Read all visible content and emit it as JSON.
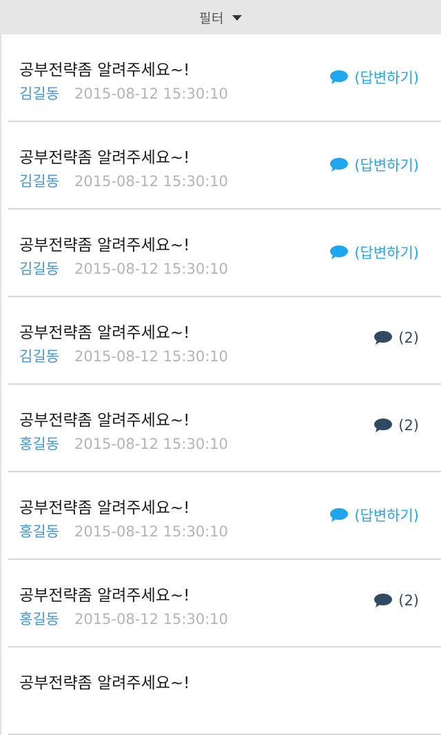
{
  "filter": {
    "label": "필터",
    "caret_icon": "caret-down-icon"
  },
  "colors": {
    "header_bg": "#e6e6e6",
    "author": "#3b96d8",
    "date": "#b4b4b4",
    "answer_accent": "#1ea7ee",
    "count_accent": "#2f4a62"
  },
  "questions": [
    {
      "title": "공부전략좀 알려주세요~!",
      "author": "김길동",
      "datetime": "2015-08-12 15:30:10",
      "action_type": "answer",
      "action_label": "(답변하기)",
      "icon": "speech-bubble-icon"
    },
    {
      "title": "공부전략좀 알려주세요~!",
      "author": "김길동",
      "datetime": "2015-08-12 15:30:10",
      "action_type": "answer",
      "action_label": "(답변하기)",
      "icon": "speech-bubble-icon"
    },
    {
      "title": "공부전략좀 알려주세요~!",
      "author": "김길동",
      "datetime": "2015-08-12 15:30:10",
      "action_type": "answer",
      "action_label": "(답변하기)",
      "icon": "speech-bubble-icon"
    },
    {
      "title": "공부전략좀 알려주세요~!",
      "author": "김길동",
      "datetime": "2015-08-12 15:30:10",
      "action_type": "count",
      "action_label": "(2)",
      "icon": "speech-bubble-icon"
    },
    {
      "title": "공부전략좀 알려주세요~!",
      "author": "홍길동",
      "datetime": "2015-08-12 15:30:10",
      "action_type": "count",
      "action_label": "(2)",
      "icon": "speech-bubble-icon"
    },
    {
      "title": "공부전략좀 알려주세요~!",
      "author": "홍길동",
      "datetime": "2015-08-12 15:30:10",
      "action_type": "answer",
      "action_label": "(답변하기)",
      "icon": "speech-bubble-icon"
    },
    {
      "title": "공부전략좀 알려주세요~!",
      "author": "홍길동",
      "datetime": "2015-08-12 15:30:10",
      "action_type": "count",
      "action_label": "(2)",
      "icon": "speech-bubble-icon"
    },
    {
      "title": "공부전략좀 알려주세요~!",
      "author": "",
      "datetime": "",
      "action_type": "",
      "action_label": "",
      "icon": ""
    }
  ]
}
